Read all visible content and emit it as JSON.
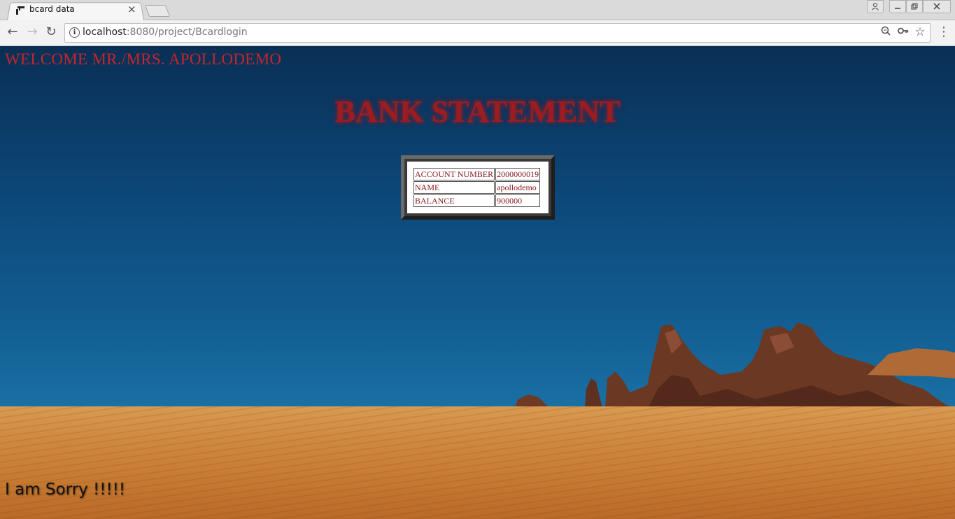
{
  "browser": {
    "tab_title": "bcard data",
    "tab_close": "×",
    "url_host": "localhost",
    "url_path": ":8080/project/Bcardlogin"
  },
  "icons": {
    "back": "←",
    "forward": "→",
    "reload": "↻",
    "zoom": "⌕",
    "key": "⚿",
    "star": "☆",
    "menu": "⋮",
    "info": "i",
    "user": "👤",
    "minimize": "▁",
    "restore": "❐",
    "close": "✕"
  },
  "page": {
    "welcome": "WELCOME MR./MRS. APOLLODEMO",
    "heading": "BANK STATEMENT",
    "statement_rows": [
      {
        "label": "ACCOUNT NUMBER",
        "value": "2000000019"
      },
      {
        "label": "NAME",
        "value": "apollodemo"
      },
      {
        "label": "BALANCE",
        "value": "900000"
      }
    ],
    "footer_message": "I am Sorry !!!!!"
  },
  "colors": {
    "welcome_text": "#c4262d",
    "heading_text": "#9b1d20",
    "table_text": "#8a1a20"
  }
}
